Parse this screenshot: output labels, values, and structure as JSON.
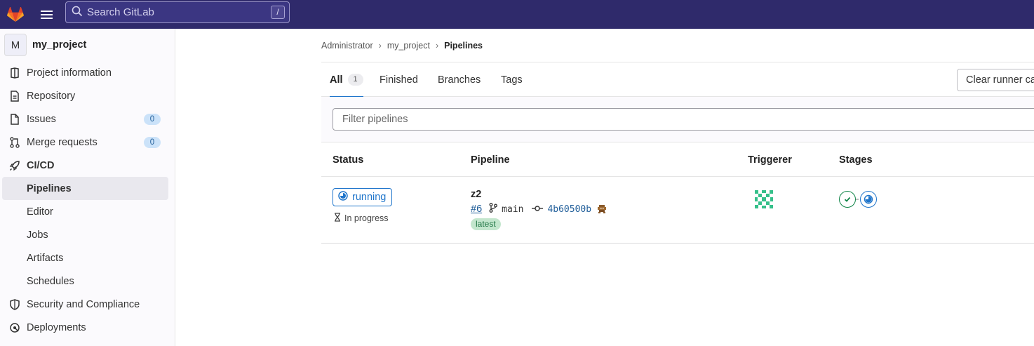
{
  "topbar": {
    "search_placeholder": "Search GitLab",
    "search_shortcut": "/",
    "background_color": "#2f2a6b"
  },
  "sidebar": {
    "project_avatar_letter": "M",
    "project_name": "my_project",
    "items": [
      {
        "label": "Project information",
        "icon": "project-info-icon"
      },
      {
        "label": "Repository",
        "icon": "repository-icon"
      },
      {
        "label": "Issues",
        "icon": "issues-icon",
        "count": "0"
      },
      {
        "label": "Merge requests",
        "icon": "merge-request-icon",
        "count": "0"
      },
      {
        "label": "CI/CD",
        "icon": "rocket-icon"
      },
      {
        "label": "Pipelines",
        "active": true
      },
      {
        "label": "Editor"
      },
      {
        "label": "Jobs"
      },
      {
        "label": "Artifacts"
      },
      {
        "label": "Schedules"
      },
      {
        "label": "Security and Compliance",
        "icon": "shield-icon"
      },
      {
        "label": "Deployments",
        "icon": "deployments-icon"
      }
    ]
  },
  "breadcrumb": {
    "items": [
      "Administrator",
      "my_project",
      "Pipelines"
    ]
  },
  "tabs": {
    "all_label": "All",
    "all_count": "1",
    "finished_label": "Finished",
    "branches_label": "Branches",
    "tags_label": "Tags",
    "clear_runner_label": "Clear runner caches"
  },
  "filter": {
    "placeholder": "Filter pipelines"
  },
  "table": {
    "headers": {
      "status": "Status",
      "pipeline": "Pipeline",
      "triggerer": "Triggerer",
      "stages": "Stages"
    },
    "rows": [
      {
        "status": "running",
        "duration_text": "In progress",
        "name": "z2",
        "id": "#6",
        "branch": "main",
        "commit": "4b60500b",
        "badge": "latest",
        "stages": [
          "success",
          "running"
        ]
      }
    ]
  },
  "colors": {
    "accent": "#1f75cb",
    "success": "#108548",
    "badge_bg": "#cbe2f9"
  }
}
